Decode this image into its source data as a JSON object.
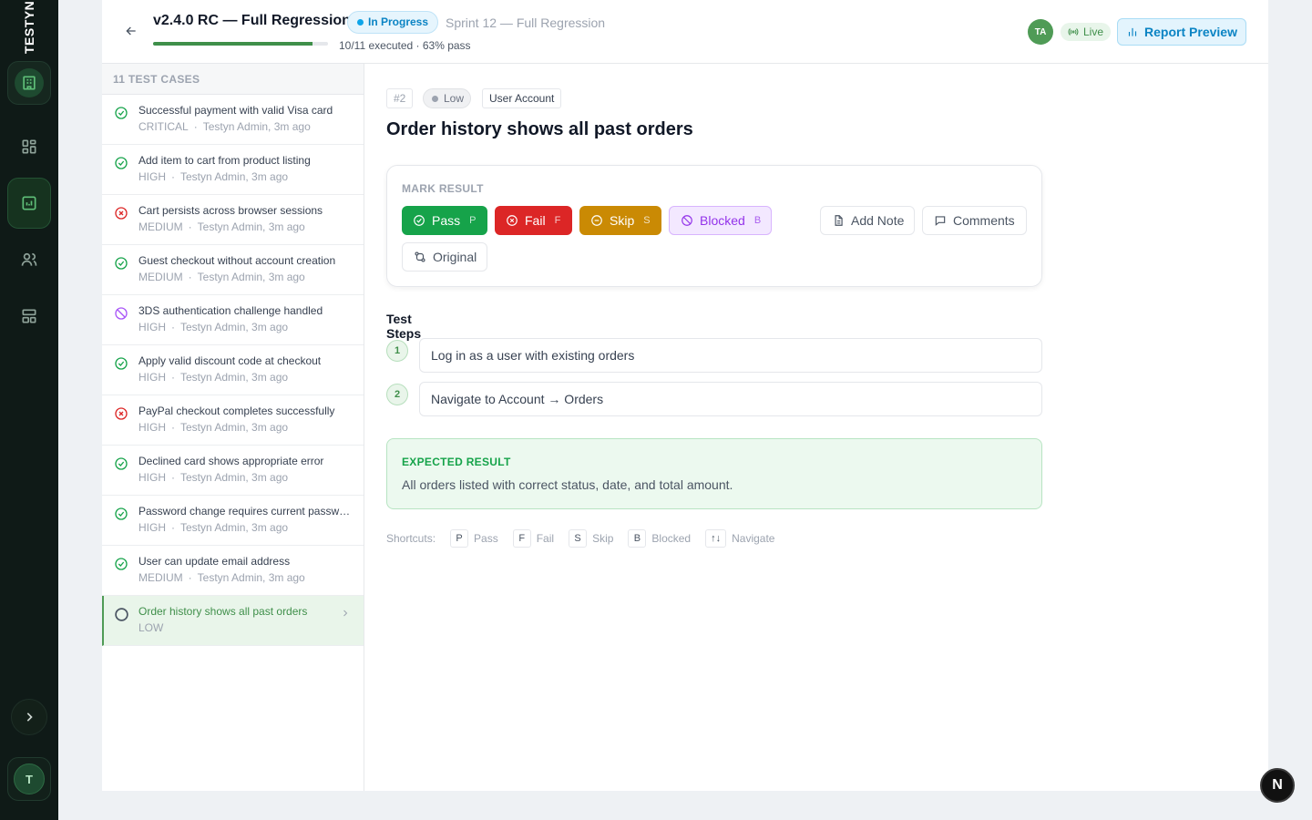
{
  "rail": {
    "brand": "TESTYN",
    "avatar_initial": "T"
  },
  "header": {
    "title": "v2.4.0 RC — Full Regression",
    "status": "In Progress",
    "sprint": "Sprint 12 — Full Regression",
    "progress_fraction": 0.91,
    "progress_text": "10/11 executed · 63% pass",
    "avatar_initials": "TA",
    "live_label": "Live",
    "report_button": "Report Preview"
  },
  "list": {
    "heading": "11 TEST CASES",
    "cases": [
      {
        "name": "Successful payment with valid Visa card",
        "priority": "CRITICAL",
        "author": "Testyn Admin, 3m ago",
        "status": "pass"
      },
      {
        "name": "Add item to cart from product listing",
        "priority": "HIGH",
        "author": "Testyn Admin, 3m ago",
        "status": "pass"
      },
      {
        "name": "Cart persists across browser sessions",
        "priority": "MEDIUM",
        "author": "Testyn Admin, 3m ago",
        "status": "fail"
      },
      {
        "name": "Guest checkout without account creation",
        "priority": "MEDIUM",
        "author": "Testyn Admin, 3m ago",
        "status": "pass"
      },
      {
        "name": "3DS authentication challenge handled",
        "priority": "HIGH",
        "author": "Testyn Admin, 3m ago",
        "status": "blocked"
      },
      {
        "name": "Apply valid discount code at checkout",
        "priority": "HIGH",
        "author": "Testyn Admin, 3m ago",
        "status": "pass"
      },
      {
        "name": "PayPal checkout completes successfully",
        "priority": "HIGH",
        "author": "Testyn Admin, 3m ago",
        "status": "fail"
      },
      {
        "name": "Declined card shows appropriate error",
        "priority": "HIGH",
        "author": "Testyn Admin, 3m ago",
        "status": "pass"
      },
      {
        "name": "Password change requires current password",
        "priority": "HIGH",
        "author": "Testyn Admin, 3m ago",
        "status": "pass"
      },
      {
        "name": "User can update email address",
        "priority": "MEDIUM",
        "author": "Testyn Admin, 3m ago",
        "status": "pass"
      },
      {
        "name": "Order history shows all past orders",
        "priority": "LOW",
        "author": "",
        "status": "untested",
        "active": true
      }
    ]
  },
  "detail": {
    "id": "#2",
    "priority": "Low",
    "area": "User Account",
    "title": "Order history shows all past orders",
    "mark_label": "MARK RESULT",
    "buttons": {
      "pass": "Pass",
      "pass_key": "P",
      "fail": "Fail",
      "fail_key": "F",
      "skip": "Skip",
      "skip_key": "S",
      "blocked": "Blocked",
      "blocked_key": "B",
      "note": "Add Note",
      "comments": "Comments",
      "original": "Original"
    },
    "steps_title": "Test Steps",
    "steps": [
      {
        "num": "1",
        "text": "Log in as a user with existing orders"
      },
      {
        "num": "2",
        "text": "Navigate to Account → Orders"
      }
    ],
    "expected_label": "EXPECTED RESULT",
    "expected_text": "All orders listed with correct status, date, and total amount.",
    "shortcuts": {
      "label": "Shortcuts:",
      "items": [
        {
          "key": "P",
          "label": "Pass"
        },
        {
          "key": "F",
          "label": "Fail"
        },
        {
          "key": "S",
          "label": "Skip"
        },
        {
          "key": "B",
          "label": "Blocked"
        },
        {
          "key": "↑↓",
          "label": "Navigate"
        }
      ]
    }
  },
  "fab_label": "N",
  "colors": {
    "pass": "#16a34a",
    "fail": "#dc2626",
    "skip": "#ca8a04",
    "blocked": "#9333ea",
    "accent": "#3f8f4a",
    "info": "#0b84c4"
  }
}
